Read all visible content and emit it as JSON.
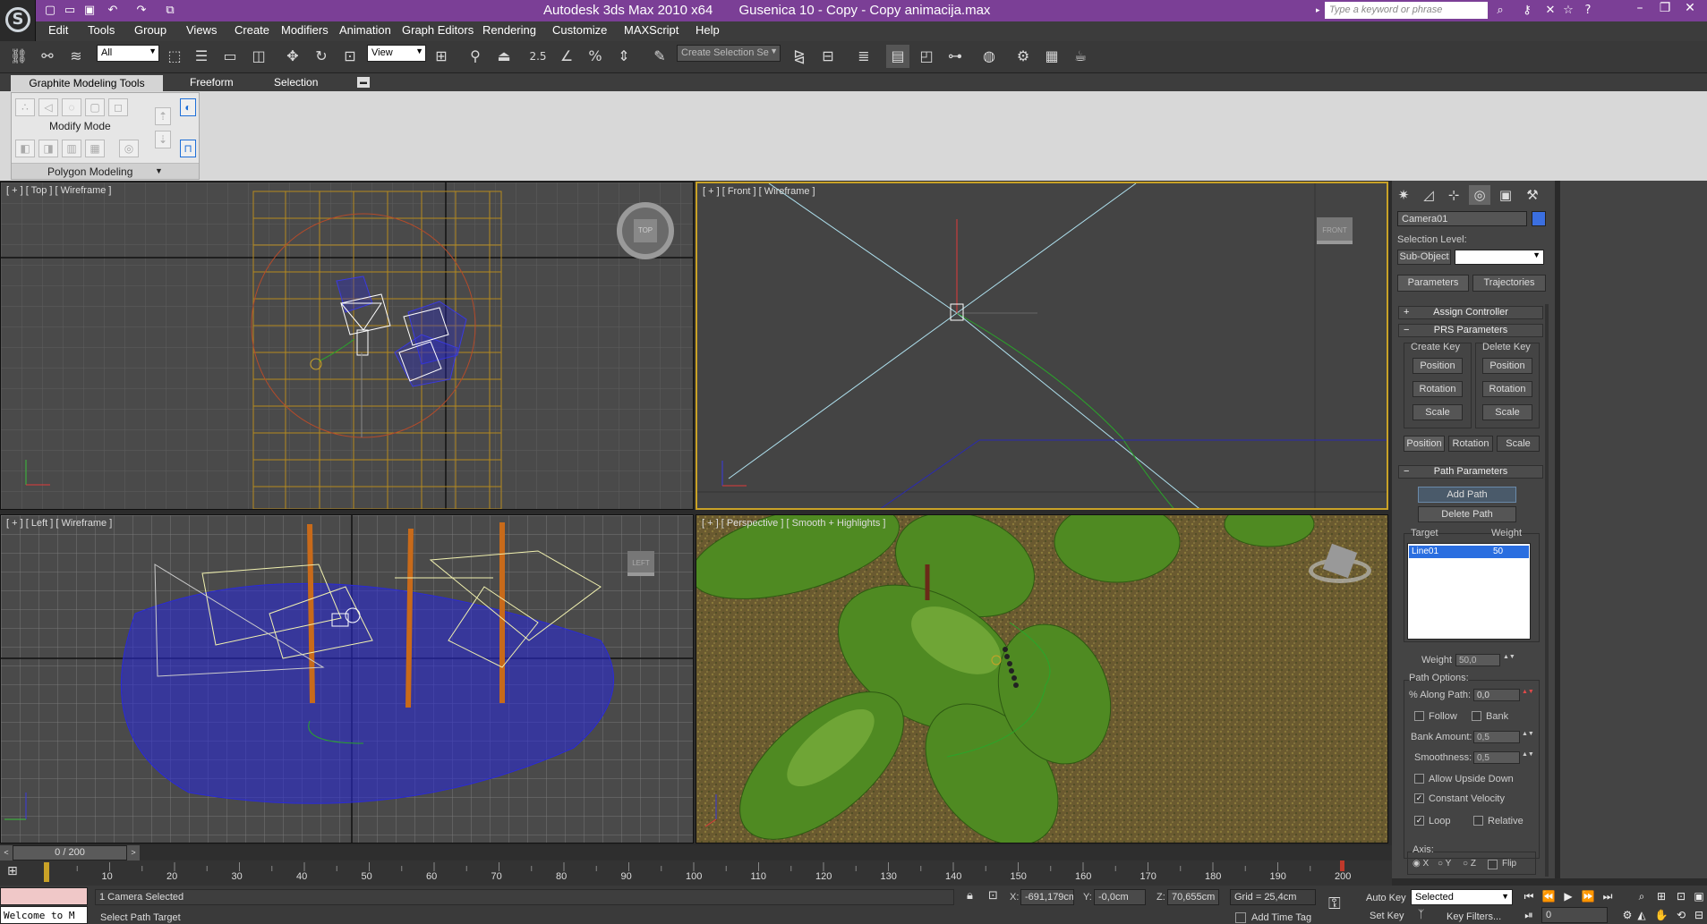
{
  "window": {
    "app_name": "Autodesk 3ds Max  2010 x64",
    "file_name": "Gusenica 10 - Copy - Copy animacija.max",
    "search_placeholder": "Type a keyword or phrase",
    "title_bg": "#7b3f96"
  },
  "menu": [
    "Edit",
    "Tools",
    "Group",
    "Views",
    "Create",
    "Modifiers",
    "Animation",
    "Graph Editors",
    "Rendering",
    "Customize",
    "MAXScript",
    "Help"
  ],
  "toolbar": {
    "selection_filter": "All",
    "reference_coord": "View",
    "snap_value": "2.5",
    "named_selection": "Create Selection Se"
  },
  "ribbon": {
    "tabs": [
      "Graphite Modeling Tools",
      "Freeform",
      "Selection"
    ],
    "panel_mode": "Modify Mode",
    "panel_footer": "Polygon Modeling"
  },
  "viewports": {
    "top": {
      "label": "[ + ] [ Top ] [ Wireframe ]",
      "cube": "TOP"
    },
    "front": {
      "label": "[ + ] [ Front ] [ Wireframe ]",
      "cube": "FRONT"
    },
    "left": {
      "label": "[ + ] [ Left ] [ Wireframe ]",
      "cube": "LEFT"
    },
    "perspective": {
      "label": "[ + ] [ Perspective ] [ Smooth + Highlights ]"
    }
  },
  "command_panel": {
    "object_name": "Camera01",
    "object_color": "#3b6fe0",
    "selection_level_label": "Selection Level:",
    "sub_object": "Sub-Object",
    "mode_buttons": [
      "Parameters",
      "Trajectories"
    ],
    "rollout_assign": "Assign Controller",
    "rollout_prs": "PRS Parameters",
    "create_key": "Create Key",
    "delete_key": "Delete Key",
    "key_buttons": [
      "Position",
      "Rotation",
      "Scale"
    ],
    "prs_tabs": [
      "Position",
      "Rotation",
      "Scale"
    ],
    "rollout_path": "Path Parameters",
    "add_path": "Add Path",
    "delete_path": "Delete Path",
    "target_header": "Target",
    "weight_header": "Weight",
    "targets": [
      {
        "name": "Line01",
        "weight": "50"
      }
    ],
    "weight_label": "Weight",
    "weight_value": "50,0",
    "path_options": "Path Options:",
    "along_path_label": "% Along Path:",
    "along_path_value": "0,0",
    "follow": "Follow",
    "bank": "Bank",
    "bank_amount_label": "Bank Amount:",
    "bank_amount_value": "0,5",
    "smoothness_label": "Smoothness:",
    "smoothness_value": "0,5",
    "allow_upside_down": "Allow Upside Down",
    "constant_velocity": "Constant Velocity",
    "loop": "Loop",
    "relative": "Relative",
    "axis": "Axis:",
    "axis_x": "X",
    "axis_y": "Y",
    "axis_z": "Z",
    "flip": "Flip",
    "constant_velocity_checked": true,
    "loop_checked": true
  },
  "timeline": {
    "frame_display": "0 / 200",
    "ticks": [
      "10",
      "20",
      "30",
      "40",
      "50",
      "60",
      "70",
      "80",
      "90",
      "100",
      "110",
      "120",
      "130",
      "140",
      "150",
      "160",
      "170",
      "180",
      "190",
      "200"
    ],
    "end_marker": "200"
  },
  "status": {
    "maxscript_listener": "Welcome to M",
    "selected_info": "1 Camera Selected",
    "prompt": "Select Path Target",
    "x_label": "X:",
    "x_value": "-691,179cm",
    "y_label": "Y:",
    "y_value": "-0,0cm",
    "z_label": "Z:",
    "z_value": "70,655cm",
    "grid": "Grid = 25,4cm",
    "add_time_tag": "Add Time Tag",
    "auto_key": "Auto Key",
    "set_key": "Set Key",
    "key_mode": "Selected",
    "key_filters": "Key Filters...",
    "current_frame": "0"
  }
}
